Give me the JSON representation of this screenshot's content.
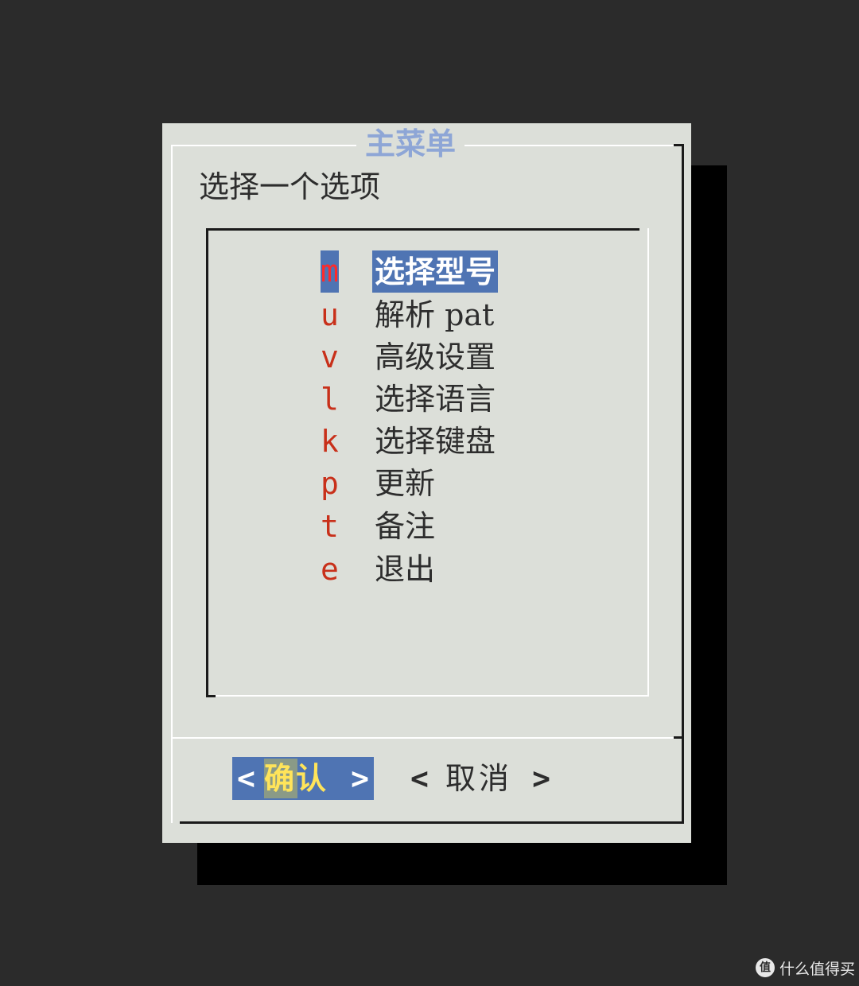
{
  "dialog": {
    "title": "主菜单",
    "prompt": "选择一个选项"
  },
  "menu": {
    "items": [
      {
        "key": "m",
        "label": "选择型号",
        "selected": true
      },
      {
        "key": "u",
        "label": "解析 pat",
        "selected": false
      },
      {
        "key": "v",
        "label": "高级设置",
        "selected": false
      },
      {
        "key": "l",
        "label": "选择语言",
        "selected": false
      },
      {
        "key": "k",
        "label": "选择键盘",
        "selected": false
      },
      {
        "key": "p",
        "label": "更新",
        "selected": false
      },
      {
        "key": "t",
        "label": "备注",
        "selected": false
      },
      {
        "key": "e",
        "label": "退出",
        "selected": false
      }
    ]
  },
  "buttons": {
    "ok": {
      "open": "<",
      "label": "确认",
      "close": ">"
    },
    "cancel": {
      "open": "<",
      "label": "取消",
      "close": ">"
    }
  },
  "watermark": {
    "icon": "值",
    "text": "什么值得买"
  },
  "colors": {
    "background": "#2b2b2b",
    "dialog": "#dcdfd9",
    "highlight": "#4f74b3",
    "hotkey": "#c8301a",
    "title": "#8ea6d6",
    "button_label": "#ffe45a"
  }
}
